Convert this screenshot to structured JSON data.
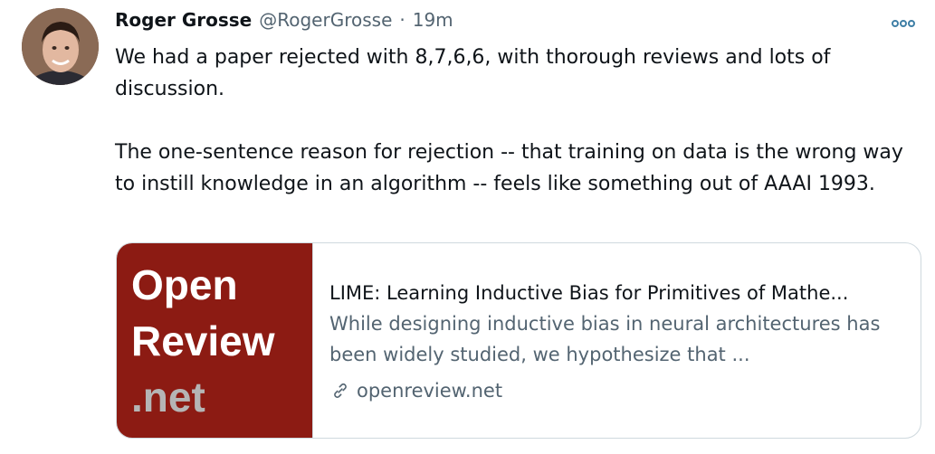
{
  "tweet": {
    "author_name": "Roger Grosse",
    "handle": "@RogerGrosse",
    "separator": "·",
    "time": "19m",
    "text_paragraphs": [
      "We had a paper rejected with 8,7,6,6, with thorough reviews and lots of discussion.",
      "The one-sentence reason for rejection -- that training on data is the wrong way to instill knowledge in an algorithm -- feels like something out of AAAI 1993."
    ]
  },
  "card": {
    "logo_lines": [
      "Open",
      "Review",
      ".net"
    ],
    "title": "LIME: Learning Inductive Bias for Primitives of Mathe...",
    "description": "While designing inductive bias in neural architectures has been widely studied, we hypothesize that ...",
    "domain": "openreview.net",
    "icon": "link-icon"
  },
  "icons": {
    "more": "more-options-icon",
    "avatar": "avatar"
  },
  "colors": {
    "text_primary": "#0f1419",
    "text_secondary": "#536471",
    "card_border": "#cfd9de",
    "openreview_red": "#8c1b13",
    "more_icon": "#1d9bf0"
  }
}
